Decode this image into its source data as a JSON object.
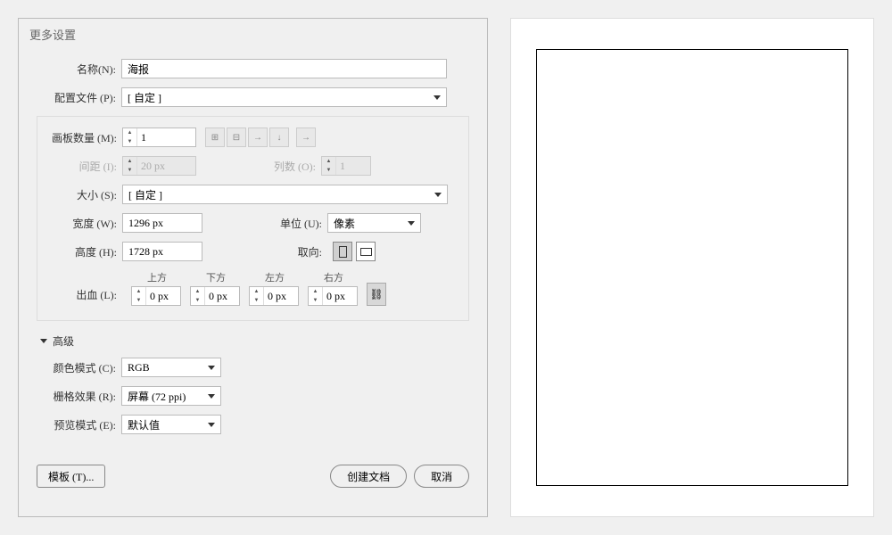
{
  "dialog": {
    "title": "更多设置",
    "name": {
      "label": "名称(N):",
      "value": "海报"
    },
    "profile": {
      "label": "配置文件 (P):",
      "value": "[ 自定 ]"
    },
    "artboards": {
      "label": "画板数量 (M):",
      "value": "1"
    },
    "spacing": {
      "label": "间距 (I):",
      "value": "20 px"
    },
    "columns": {
      "label": "列数 (O):",
      "value": "1"
    },
    "size": {
      "label": "大小 (S):",
      "value": "[ 自定 ]"
    },
    "width": {
      "label": "宽度 (W):",
      "value": "1296 px"
    },
    "units": {
      "label": "单位 (U):",
      "value": "像素"
    },
    "height": {
      "label": "高度 (H):",
      "value": "1728 px"
    },
    "orientation": {
      "label": "取向:"
    },
    "bleed": {
      "label": "出血 (L):",
      "top": {
        "label": "上方",
        "value": "0 px"
      },
      "bottom": {
        "label": "下方",
        "value": "0 px"
      },
      "left": {
        "label": "左方",
        "value": "0 px"
      },
      "right": {
        "label": "右方",
        "value": "0 px"
      }
    },
    "advanced": {
      "header": "高级",
      "colorMode": {
        "label": "颜色模式 (C):",
        "value": "RGB"
      },
      "raster": {
        "label": "栅格效果 (R):",
        "value": "屏幕 (72 ppi)"
      },
      "preview": {
        "label": "预览模式 (E):",
        "value": "默认值"
      }
    },
    "buttons": {
      "templates": "模板 (T)...",
      "create": "创建文档",
      "cancel": "取消"
    }
  }
}
